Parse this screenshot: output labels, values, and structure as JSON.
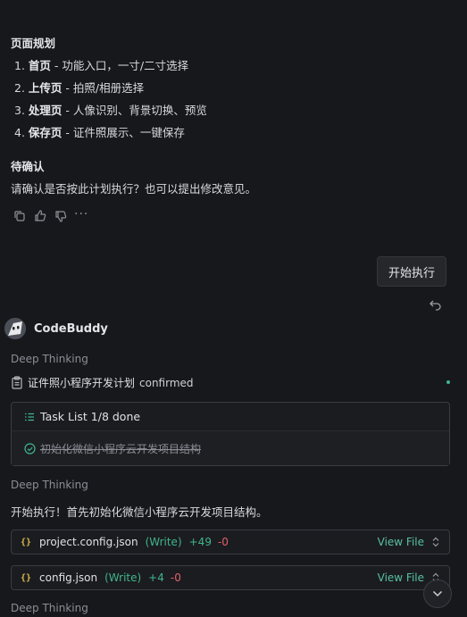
{
  "plan": {
    "heading": "页面规划",
    "items": [
      {
        "num": "1.",
        "title": "首页",
        "desc": " - 功能入口，一寸/二寸选择"
      },
      {
        "num": "2.",
        "title": "上传页",
        "desc": " - 拍照/相册选择"
      },
      {
        "num": "3.",
        "title": "处理页",
        "desc": " - 人像识别、背景切换、预览"
      },
      {
        "num": "4.",
        "title": "保存页",
        "desc": " - 证件照展示、一键保存"
      }
    ],
    "confirm_heading": "待确认",
    "confirm_text": "请确认是否按此计划执行？也可以提出修改意见。"
  },
  "user_message": "开始执行",
  "assistant": {
    "name": "CodeBuddy",
    "deep_thinking_label": "Deep Thinking",
    "plan_title": "证件照小程序开发计划",
    "plan_status": "confirmed",
    "task_list": {
      "label": "Task List 1/8 done",
      "done_item": "初始化微信小程序云开发项目结构"
    },
    "message": "开始执行！首先初始化微信小程序云开发项目结构。",
    "files": [
      {
        "name": "project.config.json",
        "mode": "(Write)",
        "added": "+49",
        "removed": "-0",
        "action": "View File"
      },
      {
        "name": "config.json",
        "mode": "(Write)",
        "added": "+4",
        "removed": "-0",
        "action": "View File"
      }
    ]
  }
}
